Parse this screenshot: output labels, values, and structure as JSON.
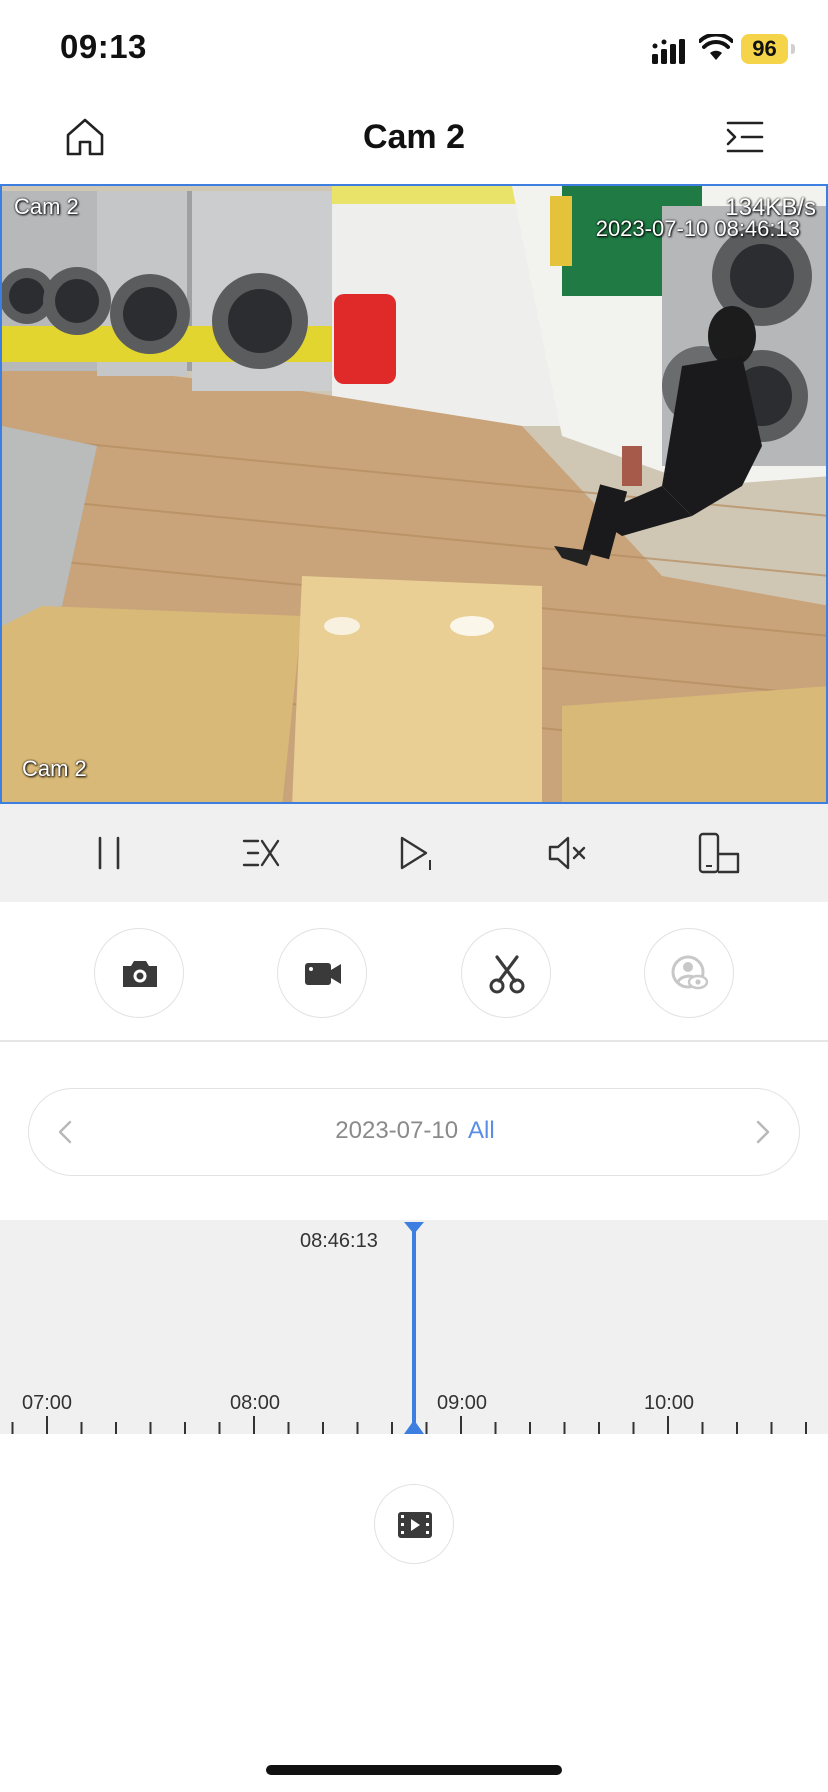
{
  "status_bar": {
    "time": "09:13",
    "battery": "96"
  },
  "header": {
    "title": "Cam 2",
    "home_icon": "home-icon",
    "menu_icon": "menu-indent-icon"
  },
  "video": {
    "overlay_channel_top": "Cam 2",
    "overlay_channel_bottom": "Cam 2",
    "bitrate": "134KB/s",
    "timestamp": "2023-07-10 08:46:13"
  },
  "player_controls": [
    {
      "name": "pause-icon"
    },
    {
      "name": "speed-icon"
    },
    {
      "name": "play-frame-icon"
    },
    {
      "name": "mute-icon"
    },
    {
      "name": "rotate-screen-icon"
    }
  ],
  "actions": [
    {
      "name": "snapshot-camera-icon"
    },
    {
      "name": "record-video-icon"
    },
    {
      "name": "cut-clip-icon"
    },
    {
      "name": "privacy-eye-icon",
      "disabled": true
    }
  ],
  "date_selector": {
    "date": "2023-07-10",
    "filter": "All"
  },
  "timeline": {
    "current_time": "08:46:13",
    "labels": [
      "07:00",
      "08:00",
      "09:00",
      "10:00"
    ],
    "accent": "#3d7fe0"
  },
  "clips_button": {
    "icon": "film-clip-icon"
  }
}
